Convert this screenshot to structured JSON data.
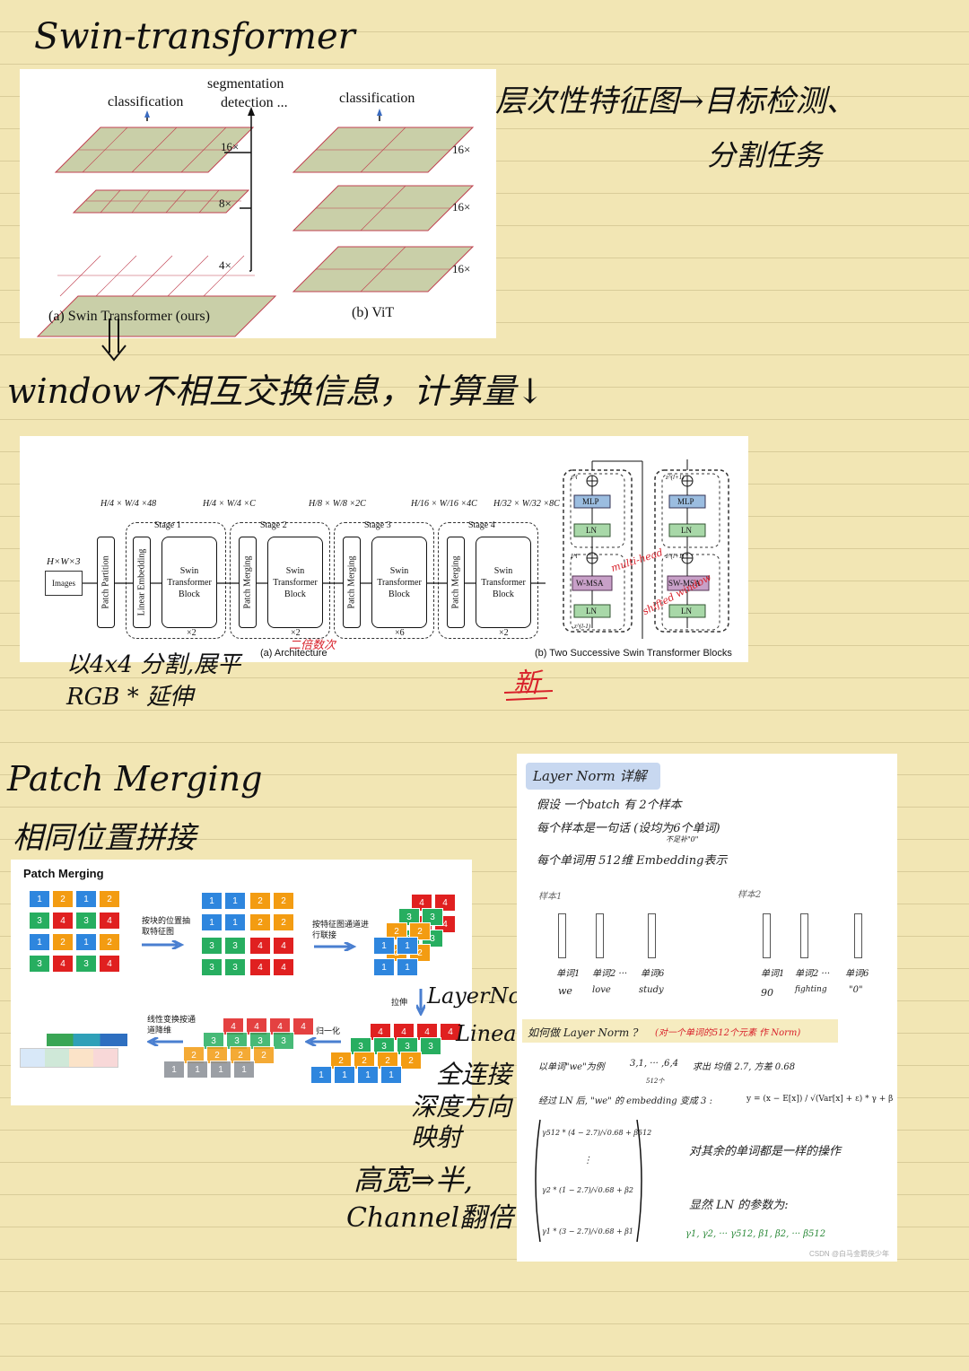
{
  "notes": {
    "title_swin": "Swin-transformer",
    "hierarchy_note_1": "层次性特征图→目标检测、",
    "hierarchy_note_2": "分割任务",
    "window_note": "window不相互交换信息，计算量↓",
    "partition_note_1": "以4x4 分割,展平",
    "partition_note_2": "RGB * 延伸",
    "new_mark": "新",
    "patch_merging_title": "Patch Merging",
    "patch_merging_sub": "相同位置拼接",
    "layer_norm_mark": "LayerNorm",
    "linear_mark": "Linear",
    "fc_mark": "全连接",
    "depth_mark": "深度方向",
    "map_mark": "映射",
    "hw_mark": "高宽⇒半,",
    "channel_mark": "Channel翻倍",
    "multi_head": "multi-head",
    "shifted_window": "shifted window",
    "stage_times": "二倍数次"
  },
  "fig1": {
    "classification_a": "classification",
    "segmentation": "segmentation",
    "detection": "detection ...",
    "classification_b": "classification",
    "scale_16": "16×",
    "scale_8": "8×",
    "scale_4": "4×",
    "caption_a": "(a) Swin Transformer (ours)",
    "caption_b": "(b) ViT"
  },
  "fig2": {
    "input_dim": "H×W×3",
    "images": "Images",
    "patch_partition": "Patch Partition",
    "linear_embedding": "Linear Embedding",
    "patch_merging": "Patch Merging",
    "swin_block": "Swin Transformer Block",
    "dim_1": "H/4 × W/4 ×48",
    "dim_2": "H/4 × W/4 ×C",
    "dim_3": "H/8 × W/8 ×2C",
    "dim_4": "H/16 × W/16 ×4C",
    "dim_5": "H/32 × W/32 ×8C",
    "stage_1": "Stage 1",
    "stage_2": "Stage 2",
    "stage_3": "Stage 3",
    "stage_4": "Stage 4",
    "x2": "×2",
    "x6": "×6",
    "caption_a": "(a) Architecture",
    "caption_b": "(b) Two Successive Swin Transformer Blocks",
    "mlp": "MLP",
    "ln": "LN",
    "wmsa": "W-MSA",
    "swmsa": "SW-MSA",
    "z_l": "z^l",
    "z_hat_l": "ẑ^l",
    "z_l_minus": "z^(l-1)",
    "z_l_plus": "z^(l+1)",
    "z_hat_l_plus": "ẑ^(l+1)"
  },
  "fig3": {
    "title": "Patch Merging",
    "step1": "按块的位置抽取特征图",
    "step2": "按特征图通道进行联接",
    "stretch": "拉伸",
    "norm": "归一化",
    "linear": "线性变换按通道降维",
    "grid": [
      [
        "1",
        "2",
        "1",
        "2"
      ],
      [
        "3",
        "4",
        "3",
        "4"
      ],
      [
        "1",
        "2",
        "1",
        "2"
      ],
      [
        "3",
        "4",
        "3",
        "4"
      ]
    ],
    "colors": {
      "1": "#2e86de",
      "2": "#f39c12",
      "3": "#27ae60",
      "4": "#e02020"
    }
  },
  "fig4": {
    "title": "Layer Norm 详解",
    "line1": "假设 一个batch 有 2个样本",
    "line2": "每个样本是一句话 (设均为6个单词)",
    "line2b": "不足补\"0\"",
    "line3": "每个单词用 512维 Embedding表示",
    "sample1": "样本1",
    "sample2": "样本2",
    "words1": [
      "单词1",
      "单词2 ···",
      "单词6"
    ],
    "tokens1": [
      "we",
      "love",
      "study"
    ],
    "words2": [
      "单词1",
      "单词2 ···",
      "单词6"
    ],
    "tokens2": [
      "90",
      "fighting",
      "\"0\""
    ],
    "question": "如何做 Layer Norm ?",
    "question_red": "(对一个单词的512个元素 作 Norm)",
    "example": "以单词\"we\"为例",
    "example_vals": "3,1, ··· ,6,4",
    "example_dim": "512个",
    "mean_var": "求出 均值 2.7, 方差 0.68",
    "after_ln": "经过 LN 后, \"we\" 的 embedding 变成 3 :",
    "formula": "y = (x − E[x]) / √(Var[x] + ε) * γ + β",
    "matrix_rows": [
      "γ512 * (4 − 2.7)/√0.68 + β512",
      "γ2 * (1 − 2.7)/√0.68 + β2",
      "γ1 * (3 − 2.7)/√0.68 + β1"
    ],
    "same_op": "对其余的单词都是一样的操作",
    "params": "显然 LN 的参数为:",
    "params_list": "γ1, γ2, ··· γ512, β1, β2, ··· β512",
    "watermark": "CSDN @白马金羁侠少年"
  }
}
